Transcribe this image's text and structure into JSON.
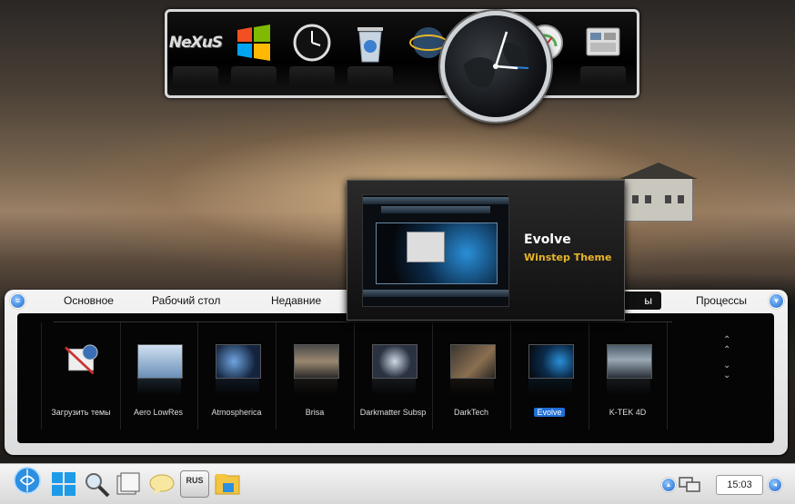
{
  "dock": {
    "items": [
      {
        "name": "nexus-logo",
        "label": "NeXuS"
      },
      {
        "name": "windows-logo-icon"
      },
      {
        "name": "clock-icon"
      },
      {
        "name": "recycle-bin-icon"
      },
      {
        "name": "network-globe-icon"
      },
      {
        "name": "world-clock-icon"
      },
      {
        "name": "speedometer-icon"
      },
      {
        "name": "control-panel-icon"
      }
    ]
  },
  "panel": {
    "tabs": [
      "Основное",
      "Рабочий стол",
      "Недавние",
      "Процессы"
    ],
    "active_tab": "ы",
    "themes": [
      {
        "label": "Загрузить темы"
      },
      {
        "label": "Aero LowRes"
      },
      {
        "label": "Atmospherica"
      },
      {
        "label": "Brisa"
      },
      {
        "label": "Darkmatter Subsp"
      },
      {
        "label": "DarkTech"
      },
      {
        "label": "Evolve",
        "selected": true
      },
      {
        "label": "K-TEK 4D"
      }
    ]
  },
  "popup": {
    "title": "Evolve",
    "subtitle": "Winstep Theme"
  },
  "taskbar": {
    "lang": "RUS",
    "time": "15:03"
  },
  "colors": {
    "accent": "#1f6fd6",
    "popup_subtitle": "#e8b52a"
  }
}
